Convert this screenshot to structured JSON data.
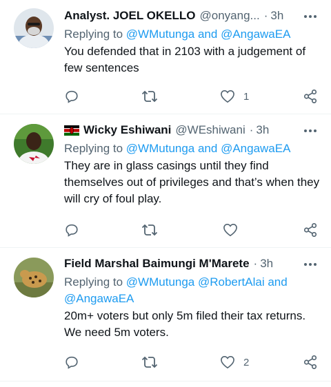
{
  "tweets": [
    {
      "name": "Analyst. JOEL OKELLO",
      "handle": "@onyang...",
      "time": "3h",
      "replying_prefix": "Replying to",
      "mentions_text": "@WMutunga and @AngawaEA",
      "text": "You defended that in 2103 with a judgement of few sentences",
      "likes": "1",
      "avatar_icon": "avatar-man-white-beard"
    },
    {
      "name": "Wicky Eshiwani",
      "handle": "@WEshiwani",
      "time": "3h",
      "flag_icon": "kenya-flag-icon",
      "replying_prefix": "Replying to",
      "mentions_text": "@WMutunga and @AngawaEA",
      "text": "They are in glass casings until they find themselves out of privileges and that’s when they will cry of foul play.",
      "likes": "",
      "avatar_icon": "avatar-man-outdoors"
    },
    {
      "name": "Field Marshal Baimungi M'Marete",
      "handle": "",
      "time": "3h",
      "replying_prefix": "Replying to",
      "mentions_line1": "@WMutunga @RobertAlai and",
      "mentions_line2": "@AngawaEA",
      "text": "20m+ voters but only 5m filed their tax returns. We need 5m voters.",
      "likes": "2",
      "avatar_icon": "avatar-leopard"
    }
  ],
  "colors": {
    "accent": "#1d9bf0",
    "secondary_text": "#536471",
    "primary_text": "#0f1419",
    "divider": "#eff3f4"
  },
  "icons": [
    "reply-icon",
    "retweet-icon",
    "like-icon",
    "share-icon",
    "more-icon"
  ]
}
